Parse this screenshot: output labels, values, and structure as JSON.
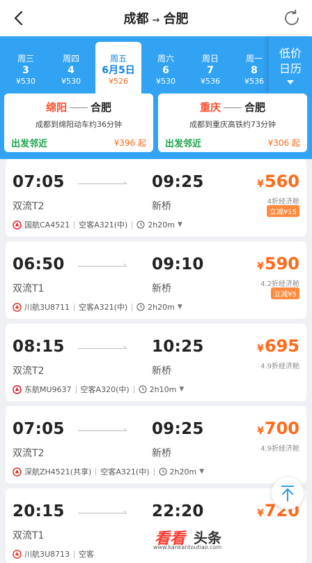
{
  "header": {
    "from": "成都",
    "arrow": "→",
    "to": "合肥"
  },
  "dates": [
    {
      "weekday": "周三",
      "day": "3",
      "price": "¥530"
    },
    {
      "weekday": "周四",
      "day": "4",
      "price": "¥530"
    },
    {
      "weekday": "周五",
      "day": "6月5日",
      "price": "¥526"
    },
    {
      "weekday": "周六",
      "day": "6",
      "price": "¥530"
    },
    {
      "weekday": "周日",
      "day": "7",
      "price": "¥536"
    },
    {
      "weekday": "周一",
      "day": "8",
      "price": "¥536"
    }
  ],
  "low_calendar": {
    "line1": "低价",
    "line2": "日历"
  },
  "nearby": [
    {
      "from": "绵阳",
      "to": "合肥",
      "desc": "成都到绵阳动车约36分钟",
      "tag": "出发邻近",
      "price": "¥396 起"
    },
    {
      "from": "重庆",
      "to": "合肥",
      "desc": "成都到重庆高铁约73分钟",
      "tag": "出发邻近",
      "price": "¥306 起"
    }
  ],
  "flights": [
    {
      "dep": "07:05",
      "arr": "09:25",
      "dep_ap": "双流T2",
      "arr_ap": "新桥",
      "price": "560",
      "cabin": "4折经济舱",
      "discount": "立减¥15",
      "airline": "国航CA4521",
      "aircraft": "空客A321(中)",
      "duration": "2h20m",
      "logo": "air-china-logo",
      "logo_color": "#e8202a"
    },
    {
      "dep": "06:50",
      "arr": "09:10",
      "dep_ap": "双流T1",
      "arr_ap": "新桥",
      "price": "590",
      "cabin": "4.2折经济舱",
      "discount": "立减¥5",
      "airline": "川航3U8711",
      "aircraft": "空客A321(中)",
      "duration": "2h20m",
      "logo": "sichuan-airlines-logo",
      "logo_color": "#e23a2e"
    },
    {
      "dep": "08:15",
      "arr": "10:25",
      "dep_ap": "双流T2",
      "arr_ap": "新桥",
      "price": "695",
      "cabin": "4.9折经济舱",
      "discount": "",
      "airline": "东航MU9637",
      "aircraft": "空客A320(中)",
      "duration": "2h10m",
      "logo": "china-eastern-logo",
      "logo_color": "#d01f2e"
    },
    {
      "dep": "07:05",
      "arr": "09:25",
      "dep_ap": "双流T2",
      "arr_ap": "新桥",
      "price": "700",
      "cabin": "4.9折经济舱",
      "discount": "",
      "airline": "深航ZH4521(共享)",
      "aircraft": "空客A321(中)",
      "duration": "2h20m",
      "logo": "shenzhen-airlines-logo",
      "logo_color": "#e02e24"
    },
    {
      "dep": "20:15",
      "arr": "22:20",
      "dep_ap": "双流T1",
      "arr_ap": "",
      "price": "720",
      "cabin": "",
      "discount": "",
      "airline": "川航3U8713",
      "aircraft": "空客",
      "duration": "",
      "logo": "sichuan-airlines-logo",
      "logo_color": "#e23a2e"
    }
  ],
  "watermark": {
    "brand": "看看",
    "brand2": "头条",
    "url": "www.kankantoutiao.com"
  },
  "colors": {
    "primary": "#32a3f3",
    "price": "#ff6a1a",
    "green": "#19a34a"
  }
}
